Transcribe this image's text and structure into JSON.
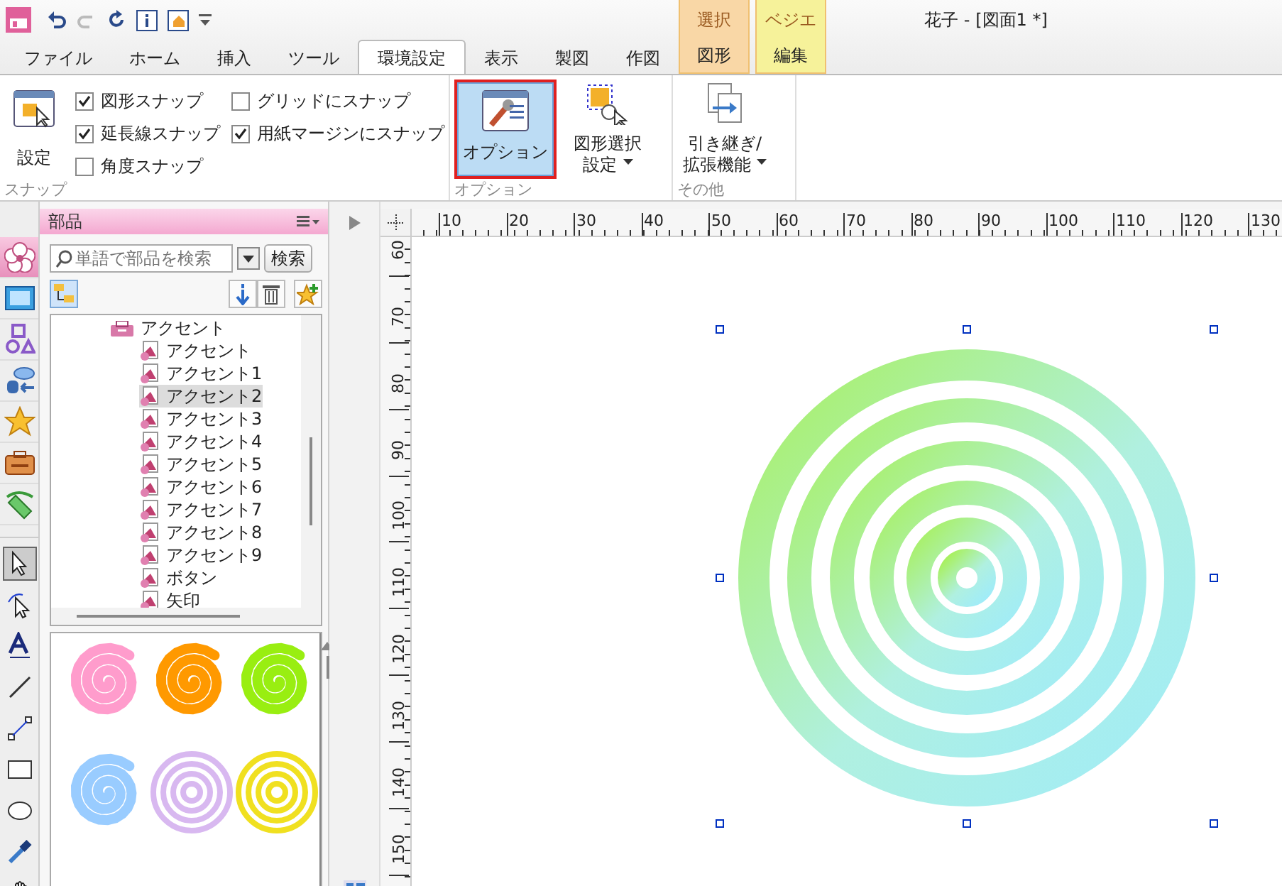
{
  "window": {
    "title": "花子 - [図面1 *]"
  },
  "tabs": [
    {
      "label": "ファイル",
      "selected": false
    },
    {
      "label": "ホーム",
      "selected": false
    },
    {
      "label": "挿入",
      "selected": false
    },
    {
      "label": "ツール",
      "selected": false
    },
    {
      "label": "環境設定",
      "selected": true
    },
    {
      "label": "表示",
      "selected": false
    },
    {
      "label": "製図",
      "selected": false
    },
    {
      "label": "作図",
      "selected": false
    }
  ],
  "context_tabs": [
    {
      "header": "選択",
      "label": "図形",
      "color": "#f9d7a6"
    },
    {
      "header": "ベジエ",
      "label": "編集",
      "color": "#f6f29a"
    }
  ],
  "ribbon": {
    "snap": {
      "label": "スナップ",
      "button": "設定",
      "checkboxes": [
        {
          "label": "図形スナップ",
          "checked": true
        },
        {
          "label": "延長線スナップ",
          "checked": true
        },
        {
          "label": "角度スナップ",
          "checked": false
        },
        {
          "label": "グリッドにスナップ",
          "checked": false
        },
        {
          "label": "用紙マージンにスナップ",
          "checked": true
        }
      ]
    },
    "options": {
      "label": "オプション",
      "buttons": [
        {
          "kind": "option",
          "lines": [
            "オプション"
          ],
          "selected": true,
          "dropdown": false
        },
        {
          "kind": "select",
          "lines": [
            "図形選択",
            "設定"
          ],
          "selected": false,
          "dropdown": true
        }
      ]
    },
    "other": {
      "label": "その他",
      "lines": [
        "引き継ぎ/",
        "拡張機能"
      ]
    }
  },
  "tool_strip": {
    "categories": [
      {
        "kind": "flower",
        "selected": true
      },
      {
        "kind": "picture",
        "selected": false
      },
      {
        "kind": "shapes",
        "selected": false
      },
      {
        "kind": "database",
        "selected": false
      },
      {
        "kind": "star",
        "selected": false
      },
      {
        "kind": "toolbox",
        "selected": false
      },
      {
        "kind": "marker",
        "selected": false
      }
    ],
    "tools": [
      {
        "kind": "arrow",
        "selected": true
      },
      {
        "kind": "node",
        "selected": false
      },
      {
        "kind": "text",
        "selected": false
      },
      {
        "kind": "line",
        "selected": false
      },
      {
        "kind": "connector",
        "selected": false
      },
      {
        "kind": "rect",
        "selected": false
      },
      {
        "kind": "ellipse",
        "selected": false
      },
      {
        "kind": "dropper",
        "selected": false
      },
      {
        "kind": "hand",
        "selected": false
      }
    ]
  },
  "parts_panel": {
    "title": "部品",
    "search": {
      "placeholder": "単語で部品を検索"
    },
    "search_button": "検索",
    "tree": {
      "label": "アクセント",
      "children": [
        {
          "label": "アクセント",
          "selected": false
        },
        {
          "label": "アクセント1",
          "selected": false
        },
        {
          "label": "アクセント2",
          "selected": true
        },
        {
          "label": "アクセント3",
          "selected": false
        },
        {
          "label": "アクセント4",
          "selected": false
        },
        {
          "label": "アクセント5",
          "selected": false
        },
        {
          "label": "アクセント6",
          "selected": false
        },
        {
          "label": "アクセント7",
          "selected": false
        },
        {
          "label": "アクセント8",
          "selected": false
        },
        {
          "label": "アクセント9",
          "selected": false
        },
        {
          "label": "ボタン",
          "selected": false
        },
        {
          "label": "矢印",
          "selected": false
        }
      ]
    },
    "thumbnails": [
      {
        "kind": "spiral",
        "color": "#ff9ccc"
      },
      {
        "kind": "spiral",
        "color": "#ff9900"
      },
      {
        "kind": "spiral",
        "color": "#99ee11"
      },
      {
        "kind": "spiral",
        "color": "#99ccff"
      },
      {
        "kind": "rings",
        "color": "#d8b8f0"
      },
      {
        "kind": "rings",
        "color": "#f0e020"
      }
    ]
  },
  "rulers": {
    "horizontal": [
      "10",
      "20",
      "30",
      "40",
      "50",
      "60",
      "70",
      "80",
      "90",
      "100",
      "110",
      "120",
      "130"
    ],
    "vertical": [
      "60",
      "70",
      "80",
      "90",
      "100",
      "110",
      "120",
      "130",
      "140",
      "150"
    ]
  }
}
